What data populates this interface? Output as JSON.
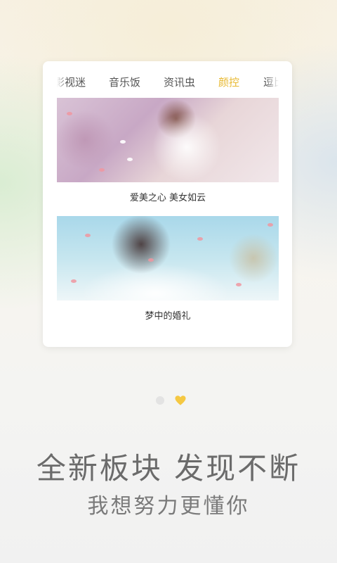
{
  "tabs": [
    {
      "label": "影视迷",
      "active": false
    },
    {
      "label": "音乐饭",
      "active": false
    },
    {
      "label": "资讯虫",
      "active": false
    },
    {
      "label": "颜控",
      "active": true
    },
    {
      "label": "逗比",
      "active": false
    }
  ],
  "cards": [
    {
      "caption": "爱美之心  美女如云",
      "image": "woman-among-pink-flowers"
    },
    {
      "caption": "梦中的婚礼",
      "image": "bride-with-petals"
    }
  ],
  "pager": {
    "pages": 2,
    "current_page": 2,
    "current_icon": "heart-icon"
  },
  "headline": "全新板块 发现不断",
  "subline": "我想努力更懂你",
  "colors": {
    "accent": "#e8b931",
    "text": "#555555",
    "headline": "#6b6b6b"
  }
}
